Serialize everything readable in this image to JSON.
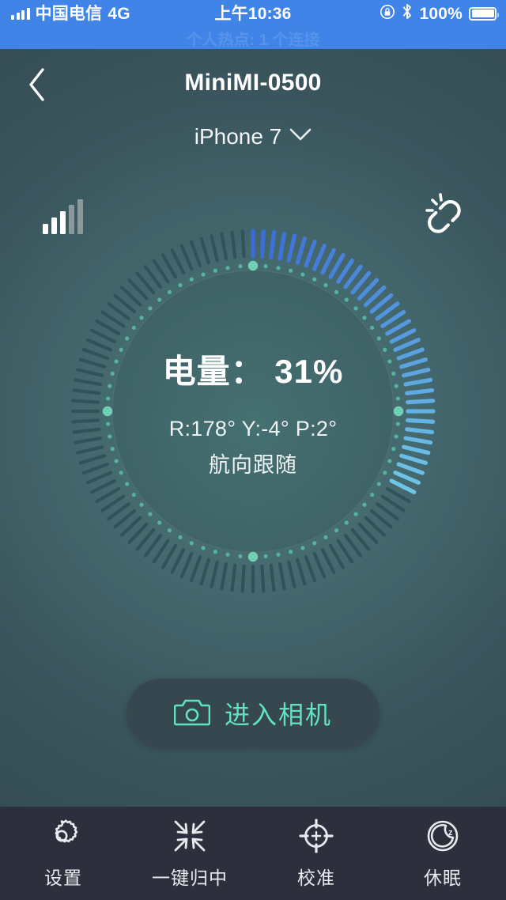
{
  "status_bar": {
    "carrier": "中国电信",
    "network": "4G",
    "time": "上午10:36",
    "battery_percent": "100%",
    "hotspot_text": "个人热点: 1 个连接",
    "icons": [
      "cell-signal-icon",
      "rotation-lock-icon",
      "bluetooth-icon",
      "battery-icon"
    ],
    "background_color": "#4084e8"
  },
  "header": {
    "back_label": "",
    "title": "MiniMI-0500",
    "device_name": "iPhone 7",
    "device_chevron": "chevron-down-icon"
  },
  "gimbal": {
    "signal_icon": "signal-strength-icon",
    "signal_bars_active": 3,
    "signal_bars_total": 5,
    "link_icon": "broken-link-icon",
    "battery_label": "电量：",
    "battery_value": "31%",
    "battery_line": "电量： 31%",
    "attitude_line": "R:178° Y:-4° P:2°",
    "roll": "178",
    "yaw": "-4",
    "pitch": "2",
    "mode_label": "航向跟随",
    "dial": {
      "total_ticks": 108,
      "active_ticks": 35,
      "active_start_deg": 0,
      "active_end_deg": 117,
      "active_color_start": "#3b6bd8",
      "active_color_end": "#6fc5e8",
      "inactive_color": "#31525a",
      "dot_color": "#56b39f",
      "cardinal_dot_color": "#6fd0b5"
    }
  },
  "camera_button": {
    "label": "进入相机",
    "icon": "camera-icon",
    "accent_color": "#5fe3c0",
    "background_color": "#37474f"
  },
  "nav": {
    "items": [
      {
        "label": "设置",
        "icon": "gear-icon"
      },
      {
        "label": "一键归中",
        "icon": "recenter-icon"
      },
      {
        "label": "校准",
        "icon": "crosshair-icon"
      },
      {
        "label": "休眠",
        "icon": "sleep-moon-icon"
      }
    ]
  }
}
